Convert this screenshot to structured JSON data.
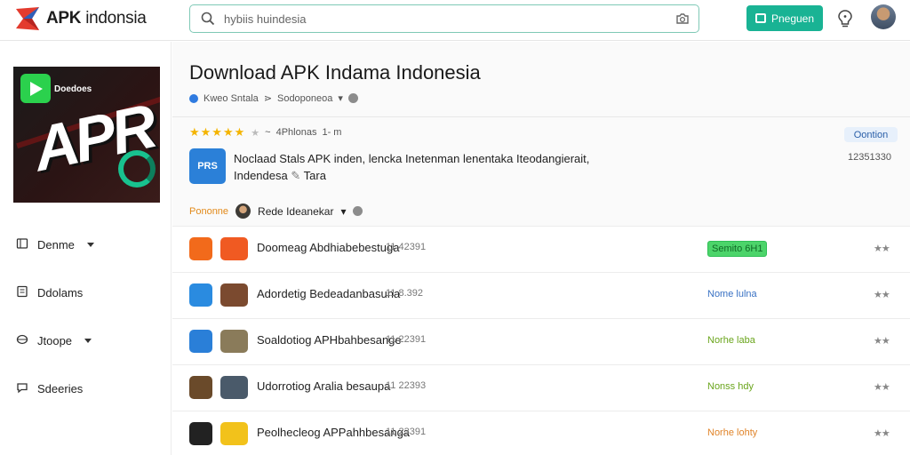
{
  "colors": {
    "accent": "#19b394",
    "link_blue": "#2f7be0",
    "star": "#f4b400",
    "status_green": "#4cd46a",
    "status_blue": "#3a72c4",
    "status_olive": "#6aa51c",
    "status_orange": "#e0842a"
  },
  "header": {
    "logo_bold": "APK",
    "logo_rest": " indonsia",
    "search_value": "hybiis huindesia",
    "program_button": "Pneguen"
  },
  "sidebar": {
    "hero_small": "Doedoes",
    "hero_big": "APR",
    "items": [
      {
        "label": "Denme",
        "icon": "apps-icon",
        "caret": true
      },
      {
        "label": "Ddolams",
        "icon": "document-icon",
        "caret": false
      },
      {
        "label": "Jtoope",
        "icon": "globe-icon",
        "caret": true
      },
      {
        "label": "Sdeeries",
        "icon": "chat-icon",
        "caret": false
      }
    ]
  },
  "main": {
    "title": "Download APK Indama Indonesia",
    "meta_author": "Kweo Sntala",
    "meta_sep": "⋗",
    "meta_category": "Sodoponeoa",
    "rating_text": "4Phlonas",
    "rating_tail": "1- m",
    "top_badge": "Oontion",
    "desc_icon_text": "PRS",
    "desc_line1": "Noclaad Stals APK inden, lencka Inetenman lenentaka Iteodangierait,",
    "desc_line2": "Indendesa",
    "desc_line2_tail": "Tara",
    "desc_number": "12351330",
    "promo_label": "Pononne",
    "promo_name": "Rede Ideanekar"
  },
  "apps": [
    {
      "name": "Doomeag Abdhiabebestuga",
      "number": "11 42391",
      "status": "Semito 6H1",
      "status_style": "pill",
      "status_color": "#116b27",
      "action": "★★",
      "icon1": "#f26a1b",
      "icon2": "#f05a22"
    },
    {
      "name": "Adordetig Bedeadanbasuna",
      "number": "11 8.392",
      "status": "Nome lulna",
      "status_style": "text",
      "status_color": "#3a72c4",
      "action": "★★",
      "icon1": "#2a8be0",
      "icon2": "#7b4a2f"
    },
    {
      "name": "Soaldotiog APHbahbesange",
      "number": "11 22391",
      "status": "Norhe laba",
      "status_style": "text",
      "status_color": "#6aa51c",
      "action": "★★",
      "icon1": "#2a7fd8",
      "icon2": "#8a7b5a"
    },
    {
      "name": "Udorrotiog Aralia besaupa",
      "number": "11 22393",
      "status": "Nonss hdy",
      "status_style": "text",
      "status_color": "#6aa51c",
      "action": "★★",
      "icon1": "#6a4a2a",
      "icon2": "#4a5a6a"
    },
    {
      "name": "Peolhecleog APPahhbesanga",
      "number": "11 23391",
      "status": "Norhe lohty",
      "status_style": "text",
      "status_color": "#e0842a",
      "action": "★★",
      "icon1": "#222222",
      "icon2": "#f2c21b"
    }
  ]
}
